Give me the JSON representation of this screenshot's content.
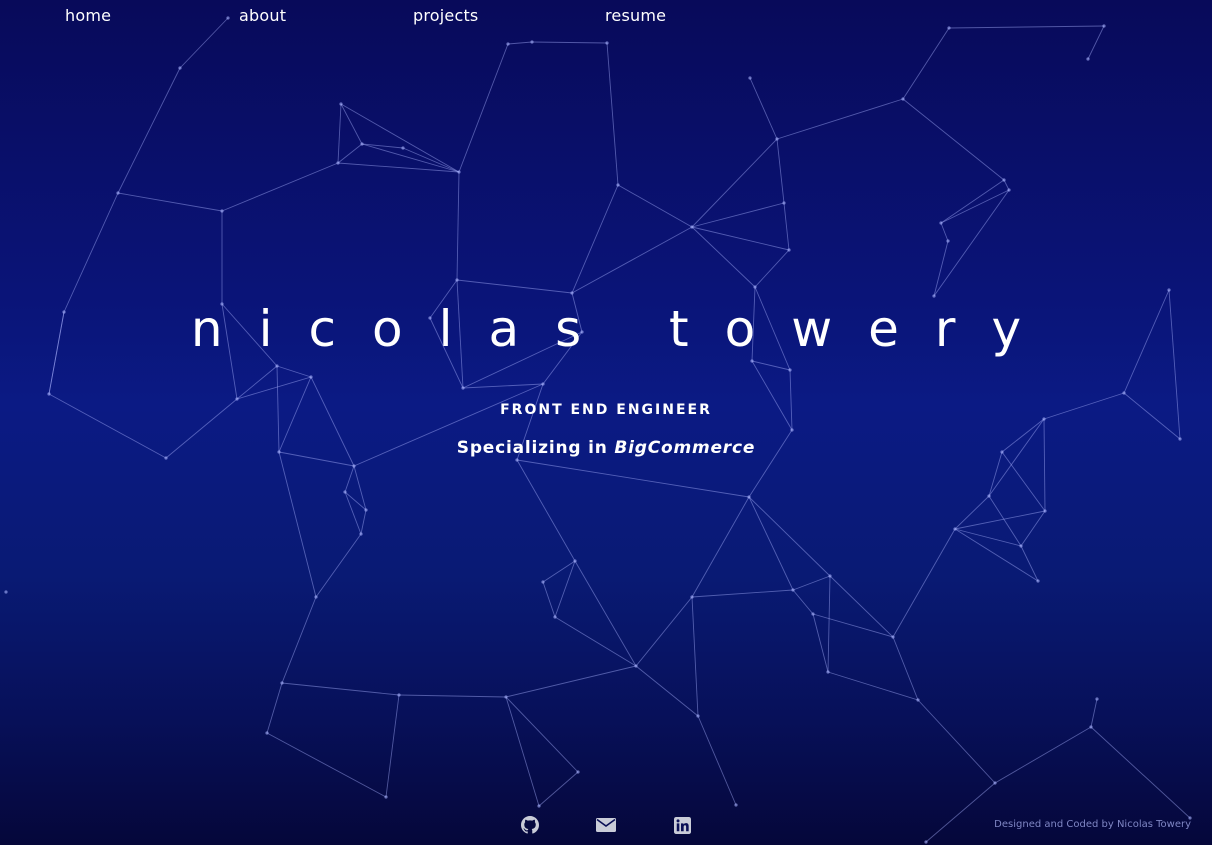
{
  "nav": {
    "home": "home",
    "about": "about",
    "projects": "projects",
    "resume": "resume"
  },
  "hero": {
    "name": "nicolas towery",
    "role": "FRONT END ENGINEER",
    "specializing_prefix": "Specializing in",
    "specializing_highlight": "BigCommerce"
  },
  "social": {
    "icons": [
      "github-icon",
      "mail-icon",
      "linkedin-icon"
    ]
  },
  "footer": {
    "credit": "Designed and Coded by Nicolas Towery"
  },
  "colors": {
    "background_top": "#080a5a",
    "background_mid": "#0b1a84",
    "background_bottom": "#05073a",
    "network_line": "#aab4ff",
    "text": "#ffffff",
    "footer_text": "#7f86c4"
  }
}
